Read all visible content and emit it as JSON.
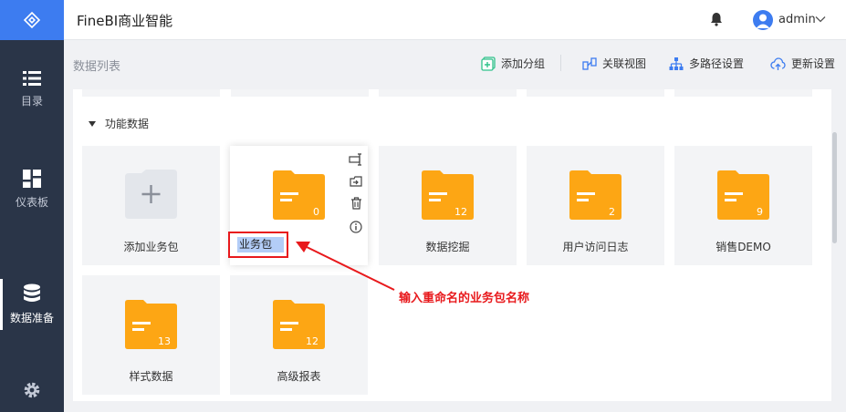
{
  "app": {
    "title": "FineBI商业智能"
  },
  "user": {
    "name": "admin"
  },
  "sidebar": {
    "items": [
      {
        "label": "目录",
        "icon": "list-icon"
      },
      {
        "label": "仪表板",
        "icon": "dashboard-icon"
      },
      {
        "label": "数据准备",
        "icon": "database-icon",
        "active": true
      }
    ]
  },
  "toolbar": {
    "page_title": "数据列表",
    "add_group": "添加分组",
    "relation_view": "关联视图",
    "multipath": "多路径设置",
    "update": "更新设置"
  },
  "group": {
    "name": "功能数据"
  },
  "cards": {
    "add_label": "添加业务包",
    "rename_value": "业务包",
    "rename_count": "0",
    "items": [
      {
        "label": "数据挖掘",
        "count": "12"
      },
      {
        "label": "用户访问日志",
        "count": "2"
      },
      {
        "label": "销售DEMO",
        "count": "9"
      },
      {
        "label": "样式数据",
        "count": "13"
      },
      {
        "label": "高级报表",
        "count": "12"
      }
    ]
  },
  "annotation": {
    "text": "输入重命名的业务包名称"
  },
  "colors": {
    "accent": "#3d7cf0",
    "sidebar": "#2a3548",
    "folder": "#fda614",
    "annotation": "#e8191c",
    "add_icon": "#2fc28a"
  }
}
